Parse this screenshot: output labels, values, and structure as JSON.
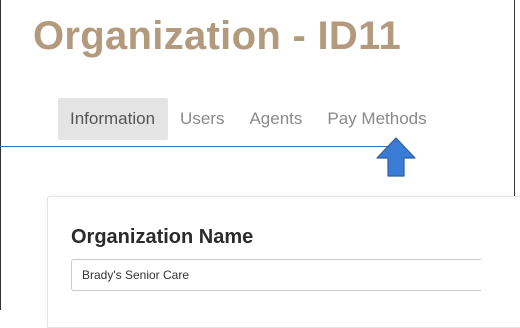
{
  "header": {
    "title": "Organization - ID11"
  },
  "tabs": [
    {
      "label": "Information",
      "active": true
    },
    {
      "label": "Users",
      "active": false
    },
    {
      "label": "Agents",
      "active": false
    },
    {
      "label": "Pay Methods",
      "active": false
    }
  ],
  "annotation": {
    "arrow_color": "#3a7bd5",
    "line_color": "#3a6bbd",
    "icon": "arrow-up-icon"
  },
  "form": {
    "org_name_label": "Organization Name",
    "org_name_value": "Brady's Senior Care"
  },
  "colors": {
    "title": "#b39a7c",
    "active_tab_bg": "#e4e4e4"
  }
}
